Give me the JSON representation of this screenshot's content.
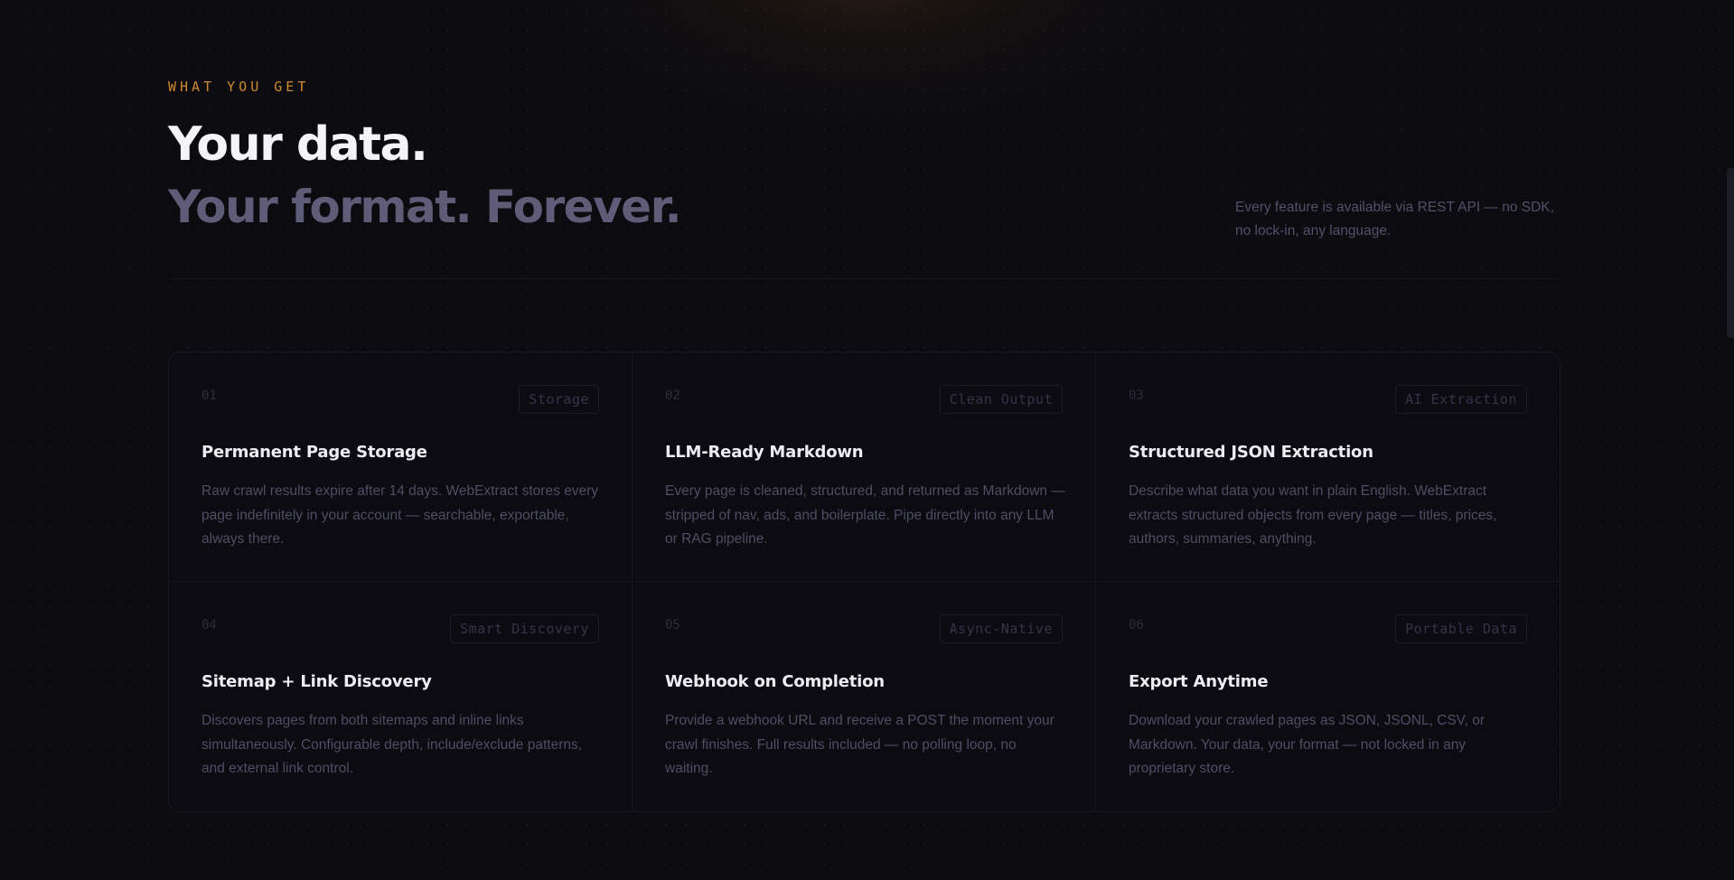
{
  "section": {
    "eyebrow": "WHAT YOU GET",
    "headline_line1": "Your data.",
    "headline_line2": "Your format. Forever.",
    "side_note": "Every feature is available via REST API — no SDK, no lock-in, any language."
  },
  "features": [
    {
      "number": "01",
      "tag": "Storage",
      "title": "Permanent Page Storage",
      "description": "Raw crawl results expire after 14 days. WebExtract stores every page indefinitely in your account — searchable, exportable, always there."
    },
    {
      "number": "02",
      "tag": "Clean Output",
      "title": "LLM-Ready Markdown",
      "description": "Every page is cleaned, structured, and returned as Markdown — stripped of nav, ads, and boilerplate. Pipe directly into any LLM or RAG pipeline."
    },
    {
      "number": "03",
      "tag": "AI Extraction",
      "title": "Structured JSON Extraction",
      "description": "Describe what data you want in plain English. WebExtract extracts structured objects from every page — titles, prices, authors, summaries, anything."
    },
    {
      "number": "04",
      "tag": "Smart Discovery",
      "title": "Sitemap + Link Discovery",
      "description": "Discovers pages from both sitemaps and inline links simultaneously. Configurable depth, include/exclude patterns, and external link control."
    },
    {
      "number": "05",
      "tag": "Async-Native",
      "title": "Webhook on Completion",
      "description": "Provide a webhook URL and receive a POST the moment your crawl finishes. Full results included — no polling loop, no waiting."
    },
    {
      "number": "06",
      "tag": "Portable Data",
      "title": "Export Anytime",
      "description": "Download your crawled pages as JSON, JSONL, CSV, or Markdown. Your data, your format — not locked in any proprietary store."
    }
  ],
  "colors": {
    "background": "#0b0b10",
    "accent": "#d08a2e",
    "headline": "#f4f4f8",
    "headline_muted": "#5f5c78"
  }
}
